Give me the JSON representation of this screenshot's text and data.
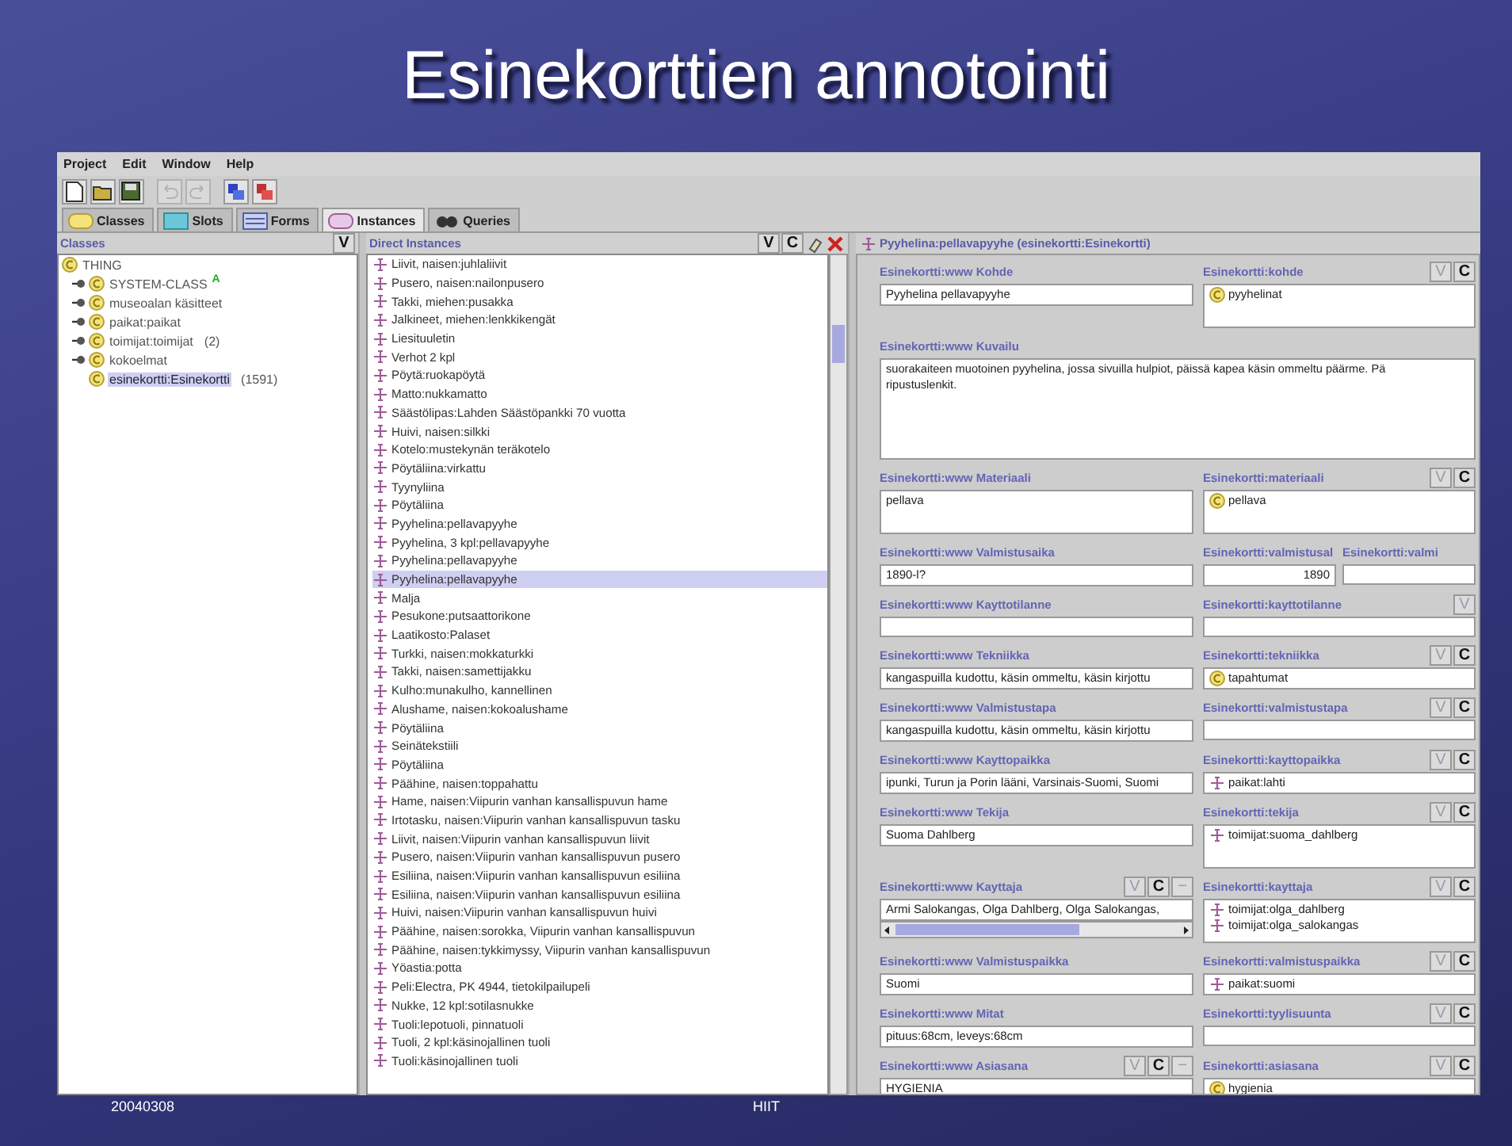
{
  "slide": {
    "title": "Esinekorttien annotointi",
    "footer_date": "20040308",
    "footer_org": "HIIT"
  },
  "menu": [
    "Project",
    "Edit",
    "Window",
    "Help"
  ],
  "toolbar": [
    {
      "disabled": false
    },
    {
      "disabled": false
    },
    {
      "disabled": false
    },
    {
      "disabled": true
    },
    {
      "disabled": true
    },
    {
      "disabled": false
    },
    {
      "disabled": false
    }
  ],
  "tabs": [
    {
      "label": "Classes",
      "selected": false
    },
    {
      "label": "Slots",
      "selected": false
    },
    {
      "label": "Forms",
      "selected": false
    },
    {
      "label": "Instances",
      "selected": true
    },
    {
      "label": "Queries",
      "selected": false
    }
  ],
  "classes": {
    "title": "Classes",
    "buttons": [
      {
        "label": "V",
        "disabled": false
      }
    ],
    "tree": [
      {
        "label": "THING",
        "children": [
          {
            "label": "SYSTEM-CLASS",
            "badge": "A",
            "expandable": true,
            "selected": false
          },
          {
            "label": "museoalan käsitteet",
            "expandable": true,
            "selected": false
          },
          {
            "label": "paikat:paikat",
            "expandable": true,
            "selected": false
          },
          {
            "label": "toimijat:toimijat",
            "count": "(2)",
            "expandable": true,
            "selected": false
          },
          {
            "label": "kokoelmat",
            "expandable": true,
            "selected": false
          },
          {
            "label": "esinekortti:Esinekortti",
            "count": "(1591)",
            "expandable": false,
            "selected": true
          }
        ]
      }
    ]
  },
  "instances": {
    "title": "Direct Instances",
    "buttons": [
      {
        "label": "V",
        "disabled": false
      },
      {
        "label": "C",
        "disabled": false
      }
    ],
    "items": [
      {
        "label": "Liivit, naisen:juhlaliivit",
        "selected": false
      },
      {
        "label": "Pusero, naisen:nailonpusero",
        "selected": false
      },
      {
        "label": "Takki, miehen:pusakka",
        "selected": false
      },
      {
        "label": "Jalkineet, miehen:lenkkikengät",
        "selected": false
      },
      {
        "label": "Liesituuletin",
        "selected": false
      },
      {
        "label": "Verhot 2 kpl",
        "selected": false
      },
      {
        "label": "Pöytä:ruokapöytä",
        "selected": false
      },
      {
        "label": "Matto:nukkamatto",
        "selected": false
      },
      {
        "label": "Säästölipas:Lahden Säästöpankki 70 vuotta",
        "selected": false
      },
      {
        "label": "Huivi, naisen:silkki",
        "selected": false
      },
      {
        "label": "Kotelo:mustekynän teräkotelo",
        "selected": false
      },
      {
        "label": "Pöytäliina:virkattu",
        "selected": false
      },
      {
        "label": "Tyynyliina",
        "selected": false
      },
      {
        "label": "Pöytäliina",
        "selected": false
      },
      {
        "label": "Pyyhelina:pellavapyyhe",
        "selected": false
      },
      {
        "label": "Pyyhelina, 3 kpl:pellavapyyhe",
        "selected": false
      },
      {
        "label": "Pyyhelina:pellavapyyhe",
        "selected": false
      },
      {
        "label": "Pyyhelina:pellavapyyhe",
        "selected": true
      },
      {
        "label": "Malja",
        "selected": false
      },
      {
        "label": "Pesukone:putsaattorikone",
        "selected": false
      },
      {
        "label": "Laatikosto:Palaset",
        "selected": false
      },
      {
        "label": "Turkki, naisen:mokkaturkki",
        "selected": false
      },
      {
        "label": "Takki, naisen:samettijakku",
        "selected": false
      },
      {
        "label": "Kulho:munakulho, kannellinen",
        "selected": false
      },
      {
        "label": "Alushame, naisen:kokoalushame",
        "selected": false
      },
      {
        "label": "Pöytäliina",
        "selected": false
      },
      {
        "label": "Seinätekstiili",
        "selected": false
      },
      {
        "label": "Pöytäliina",
        "selected": false
      },
      {
        "label": "Päähine, naisen:toppahattu",
        "selected": false
      },
      {
        "label": "Hame, naisen:Viipurin vanhan kansallispuvun hame",
        "selected": false
      },
      {
        "label": "Irtotasku, naisen:Viipurin vanhan kansallispuvun tasku",
        "selected": false
      },
      {
        "label": "Liivit, naisen:Viipurin vanhan kansallispuvun liivit",
        "selected": false
      },
      {
        "label": "Pusero, naisen:Viipurin vanhan kansallispuvun pusero",
        "selected": false
      },
      {
        "label": "Esiliina, naisen:Viipurin vanhan kansallispuvun esiliina",
        "selected": false
      },
      {
        "label": "Esiliina, naisen:Viipurin vanhan kansallispuvun esiliina",
        "selected": false
      },
      {
        "label": "Huivi, naisen:Viipurin vanhan kansallispuvun huivi",
        "selected": false
      },
      {
        "label": "Päähine, naisen:sorokka, Viipurin vanhan kansallispuvun",
        "selected": false
      },
      {
        "label": "Päähine, naisen:tykkimyssy, Viipurin vanhan kansallispuvun",
        "selected": false
      },
      {
        "label": "Yöastia:potta",
        "selected": false
      },
      {
        "label": "Peli:Electra, PK 4944, tietokilpailupeli",
        "selected": false
      },
      {
        "label": "Nukke, 12 kpl:sotilasnukke",
        "selected": false
      },
      {
        "label": "Tuoli:lepotuoli, pinnatuoli",
        "selected": false
      },
      {
        "label": "Tuoli, 2 kpl:käsinojallinen tuoli",
        "selected": false
      },
      {
        "label": "Tuoli:käsinojallinen tuoli",
        "selected": false
      }
    ]
  },
  "form": {
    "title": "Pyyhelina:pellavapyyhe (esinekortti:Esinekortti)",
    "rows": [
      {
        "left": {
          "label": "Esinekortti:www Kohde",
          "kind": "text",
          "value": "Pyyhelina pellavapyyhe"
        },
        "right": [
          {
            "label": "Esinekortti:kohde",
            "buttons": [
              {
                "label": "V",
                "disabled": true
              },
              {
                "label": "C",
                "disabled": false
              }
            ],
            "kind": "list",
            "tall": true,
            "items": [
              {
                "kind": "class",
                "label": "pyyhelinat"
              }
            ]
          }
        ]
      },
      {
        "left": {
          "label": "Esinekortti:www Kuvailu",
          "kind": "textarea",
          "value": "suorakaiteen muotoinen pyyhelina, jossa sivuilla hulpiot, päissä kapea käsin ommeltu päärme. Pä\nripustuslenkit."
        }
      },
      {
        "left": {
          "label": "Esinekortti:www Materiaali",
          "kind": "memo",
          "value": "pellava"
        },
        "right": [
          {
            "label": "Esinekortti:materiaali",
            "buttons": [
              {
                "label": "V",
                "disabled": true
              },
              {
                "label": "C",
                "disabled": false
              }
            ],
            "kind": "list",
            "tall": true,
            "items": [
              {
                "kind": "class",
                "label": "pellava"
              }
            ]
          }
        ]
      },
      {
        "left": {
          "label": "Esinekortti:www Valmistusaika",
          "kind": "text",
          "value": "1890-l?"
        },
        "right": [
          {
            "label": "Esinekortti:valmistusal",
            "kind": "number",
            "value": "1890"
          },
          {
            "label": "Esinekortti:valmi",
            "kind": "text"
          }
        ]
      },
      {
        "left": {
          "label": "Esinekortti:www Kayttotilanne",
          "kind": "text"
        },
        "right": [
          {
            "label": "Esinekortti:kayttotilanne",
            "buttons": [
              {
                "label": "V",
                "disabled": true
              }
            ],
            "kind": "text"
          }
        ]
      },
      {
        "left": {
          "label": "Esinekortti:www Tekniikka",
          "kind": "text",
          "value": "kangaspuilla kudottu, käsin ommeltu, käsin kirjottu"
        },
        "right": [
          {
            "label": "Esinekortti:tekniikka",
            "buttons": [
              {
                "label": "V",
                "disabled": true
              },
              {
                "label": "C",
                "disabled": false
              }
            ],
            "kind": "list",
            "tall": false,
            "items": [
              {
                "kind": "class",
                "label": "tapahtumat"
              }
            ]
          }
        ]
      },
      {
        "left": {
          "label": "Esinekortti:www Valmistustapa",
          "kind": "text",
          "value": "kangaspuilla kudottu, käsin ommeltu, käsin kirjottu"
        },
        "right": [
          {
            "label": "Esinekortti:valmistustapa",
            "buttons": [
              {
                "label": "V",
                "disabled": true
              },
              {
                "label": "C",
                "disabled": false
              }
            ],
            "kind": "text"
          }
        ]
      },
      {
        "left": {
          "label": "Esinekortti:www Kayttopaikka",
          "kind": "text",
          "value": "ipunki, Turun ja Porin lääni, Varsinais-Suomi, Suomi"
        },
        "right": [
          {
            "label": "Esinekortti:kayttopaikka",
            "buttons": [
              {
                "label": "V",
                "disabled": true
              },
              {
                "label": "C",
                "disabled": false
              }
            ],
            "kind": "list",
            "tall": false,
            "items": [
              {
                "kind": "instance",
                "label": "paikat:lahti"
              }
            ]
          }
        ]
      },
      {
        "left": {
          "label": "Esinekortti:www Tekija",
          "kind": "text",
          "value": "Suoma Dahlberg"
        },
        "right": [
          {
            "label": "Esinekortti:tekija",
            "buttons": [
              {
                "label": "V",
                "disabled": true
              },
              {
                "label": "C",
                "disabled": false
              }
            ],
            "kind": "list",
            "tall": true,
            "items": [
              {
                "kind": "instance",
                "label": "toimijat:suoma_dahlberg"
              }
            ]
          }
        ]
      },
      {
        "left": {
          "label": "Esinekortti:www Kayttaja",
          "buttons": [
            {
              "label": "V",
              "disabled": true
            },
            {
              "label": "C",
              "disabled": false
            },
            {
              "label": "−",
              "disabled": true
            }
          ],
          "kind": "scroll",
          "value": "Armi Salokangas, Olga Dahlberg, Olga Salokangas,"
        },
        "right": [
          {
            "label": "Esinekortti:kayttaja",
            "buttons": [
              {
                "label": "V",
                "disabled": true
              },
              {
                "label": "C",
                "disabled": false
              }
            ],
            "kind": "list",
            "tall": true,
            "items": [
              {
                "kind": "instance",
                "label": "toimijat:olga_dahlberg"
              },
              {
                "kind": "instance",
                "label": "toimijat:olga_salokangas"
              }
            ]
          }
        ]
      },
      {
        "left": {
          "label": "Esinekortti:www Valmistuspaikka",
          "kind": "text",
          "value": "Suomi"
        },
        "right": [
          {
            "label": "Esinekortti:valmistuspaikka",
            "buttons": [
              {
                "label": "V",
                "disabled": true
              },
              {
                "label": "C",
                "disabled": false
              }
            ],
            "kind": "list",
            "tall": false,
            "items": [
              {
                "kind": "instance",
                "label": "paikat:suomi"
              }
            ]
          }
        ]
      },
      {
        "left": {
          "label": "Esinekortti:www Mitat",
          "kind": "text",
          "value": "pituus:68cm, leveys:68cm"
        },
        "right": [
          {
            "label": "Esinekortti:tyylisuunta",
            "buttons": [
              {
                "label": "V",
                "disabled": true
              },
              {
                "label": "C",
                "disabled": false
              }
            ],
            "kind": "text"
          }
        ]
      },
      {
        "left": {
          "label": "Esinekortti:www Asiasana",
          "buttons": [
            {
              "label": "V",
              "disabled": true
            },
            {
              "label": "C",
              "disabled": false
            },
            {
              "label": "−",
              "disabled": true
            }
          ],
          "kind": "text",
          "value": "HYGIENIA"
        },
        "right": [
          {
            "label": "Esinekortti:asiasana",
            "buttons": [
              {
                "label": "V",
                "disabled": true
              },
              {
                "label": "C",
                "disabled": false
              }
            ],
            "kind": "list",
            "tall": false,
            "items": [
              {
                "kind": "class",
                "label": "hygienia"
              }
            ]
          }
        ]
      }
    ]
  }
}
